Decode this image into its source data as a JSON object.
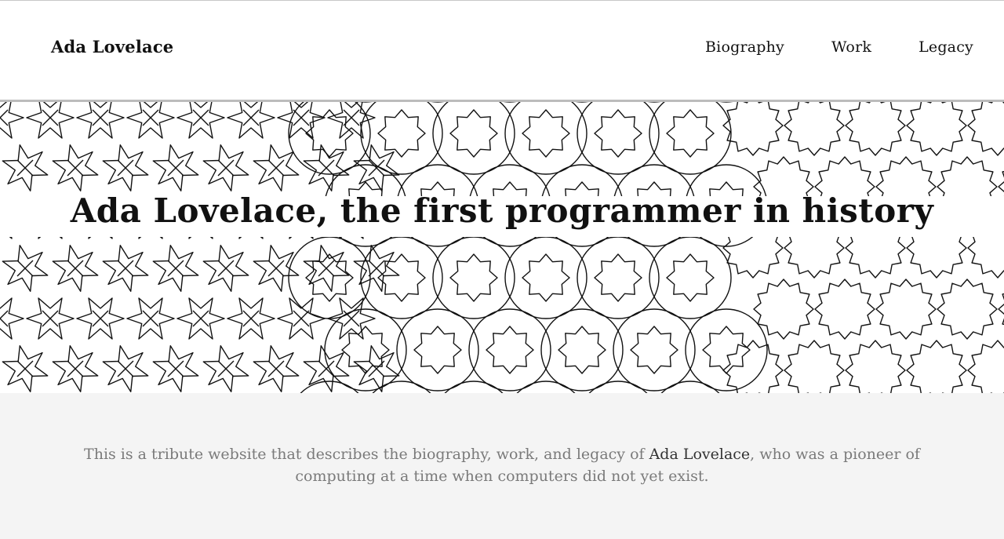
{
  "header": {
    "brand": "Ada Lovelace",
    "nav": [
      {
        "label": "Biography"
      },
      {
        "label": "Work"
      },
      {
        "label": "Legacy"
      }
    ]
  },
  "hero": {
    "title": "Ada Lovelace, the first programmer in history",
    "background": "geometric-tessellation-pattern"
  },
  "intro": {
    "text_before": "This is a tribute website that describes the biography, work, and legacy of ",
    "name": "Ada Lovelace",
    "text_after": ", who was a pioneer of computing at a time when computers did not yet exist."
  },
  "colors": {
    "background": "#ffffff",
    "text": "#111111",
    "intro_background": "#f4f4f4",
    "intro_text": "#7a7a7a",
    "rule": "#bcbcbc"
  }
}
